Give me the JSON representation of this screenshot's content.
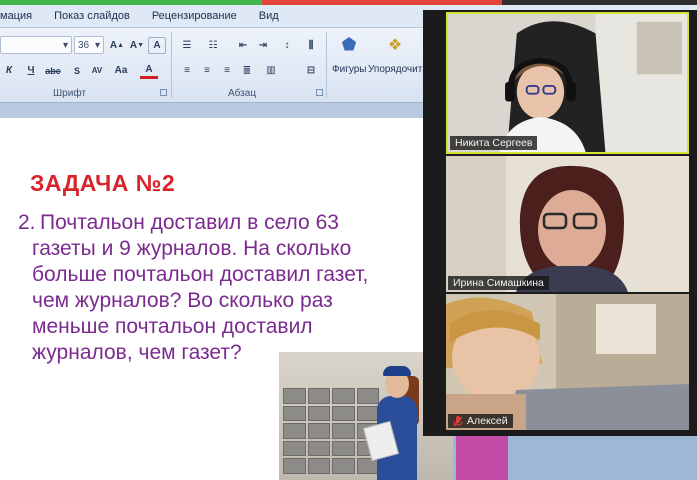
{
  "ribbon": {
    "tabs": [
      "мация",
      "Показ слайдов",
      "Рецензирование",
      "Вид"
    ],
    "font_size_value": "36",
    "font_group_label": "Шрифт",
    "paragraph_group_label": "Абзац",
    "shapes_label": "Фигуры",
    "arrange_label": "Упорядочить"
  },
  "slide": {
    "title": "ЗАДАЧА №2",
    "problem_number": "2.",
    "problem_lines": [
      "Почтальон доставил в село 63",
      "газеты и 9 журналов. На сколько",
      "больше почтальон доставил газет,",
      "чем журналов? Во сколько раз",
      "меньше почтальон доставил",
      "журналов, чем газет?"
    ]
  },
  "participants": [
    {
      "name": "Никита Сергеев",
      "muted": false,
      "active_speaker": true
    },
    {
      "name": "Ирина Симашкина",
      "muted": false,
      "active_speaker": false
    },
    {
      "name": "Алексей",
      "muted": true,
      "active_speaker": false
    }
  ],
  "colors": {
    "title": "#d8232a",
    "body_text": "#7b2b8f",
    "active_speaker_border": "#d5e335",
    "muted_icon": "#e23b3b"
  }
}
